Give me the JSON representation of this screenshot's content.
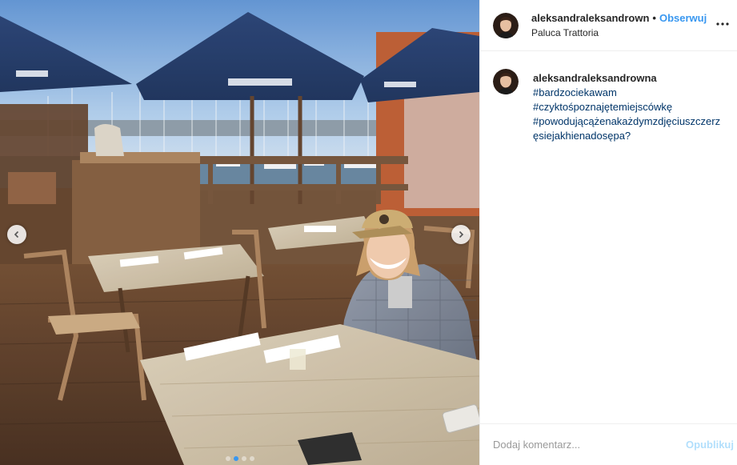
{
  "post": {
    "author": {
      "username": "aleksandraleksandrown",
      "separator": "•",
      "follow_label": "Obserwuj",
      "location": "Paluca Trattoria",
      "avatar_icon": "profile-avatar"
    },
    "more_icon": "more-options-icon",
    "caption": {
      "username": "aleksandraleksandrowna",
      "tags": [
        "#bardzociekawam",
        "#czyktośpoznajętemiejscówkę",
        "#powodującążenakażdymzdjęciuszczerzęsiejakhienadosępa?"
      ]
    },
    "carousel": {
      "prev_icon": "chevron-left-icon",
      "next_icon": "chevron-right-icon",
      "slides": 4,
      "active_slide": 2
    },
    "comment_box": {
      "placeholder": "Dodaj komentarz...",
      "publish_label": "Opublikuj"
    },
    "colors": {
      "link": "#3897f0",
      "hashtag": "#003569",
      "publish_disabled": "#b2dffc",
      "border": "#efefef"
    }
  }
}
